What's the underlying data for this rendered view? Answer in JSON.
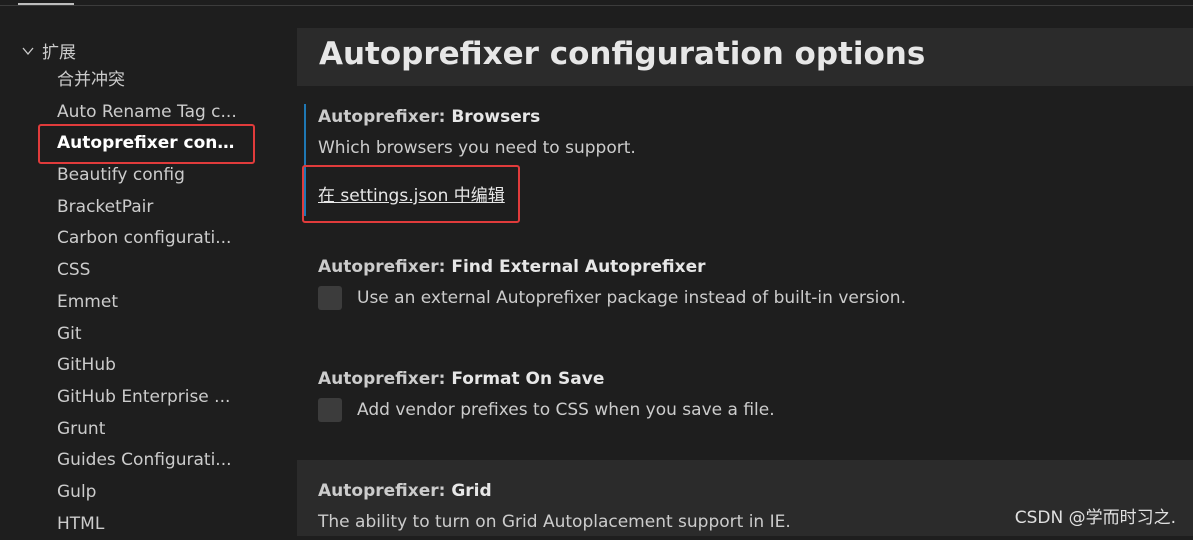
{
  "toc": {
    "section_label": "扩展",
    "items": [
      {
        "label": "合并冲突",
        "active": false
      },
      {
        "label": "Auto Rename Tag c...",
        "active": false
      },
      {
        "label": "Autoprefixer conf...",
        "active": true
      },
      {
        "label": "Beautify config",
        "active": false
      },
      {
        "label": "BracketPair",
        "active": false
      },
      {
        "label": "Carbon configurati...",
        "active": false
      },
      {
        "label": "CSS",
        "active": false
      },
      {
        "label": "Emmet",
        "active": false
      },
      {
        "label": "Git",
        "active": false
      },
      {
        "label": "GitHub",
        "active": false
      },
      {
        "label": "GitHub Enterprise ...",
        "active": false
      },
      {
        "label": "Grunt",
        "active": false
      },
      {
        "label": "Guides Configurati...",
        "active": false
      },
      {
        "label": "Gulp",
        "active": false
      },
      {
        "label": "HTML",
        "active": false
      }
    ]
  },
  "main": {
    "title": "Autoprefixer configuration options",
    "settings": [
      {
        "category": "Autoprefixer: ",
        "name": "Browsers",
        "description": "Which browsers you need to support.",
        "link": "在 settings.json 中编辑"
      },
      {
        "category": "Autoprefixer: ",
        "name": "Find External Autoprefixer",
        "description": "Use an external Autoprefixer package instead of built-in version."
      },
      {
        "category": "Autoprefixer: ",
        "name": "Format On Save",
        "description": "Add vendor prefixes to CSS when you save a file."
      },
      {
        "category": "Autoprefixer: ",
        "name": "Grid",
        "description": "The ability to turn on Grid Autoplacement support in IE."
      }
    ]
  },
  "watermark": "CSDN @学而时习之.",
  "colors": {
    "background": "#1e1e1e",
    "header_background": "#2b2b2b",
    "focus_bar": "#1f78b4",
    "highlight_box": "#e03b3b",
    "checkbox": "#3c3c3c"
  }
}
